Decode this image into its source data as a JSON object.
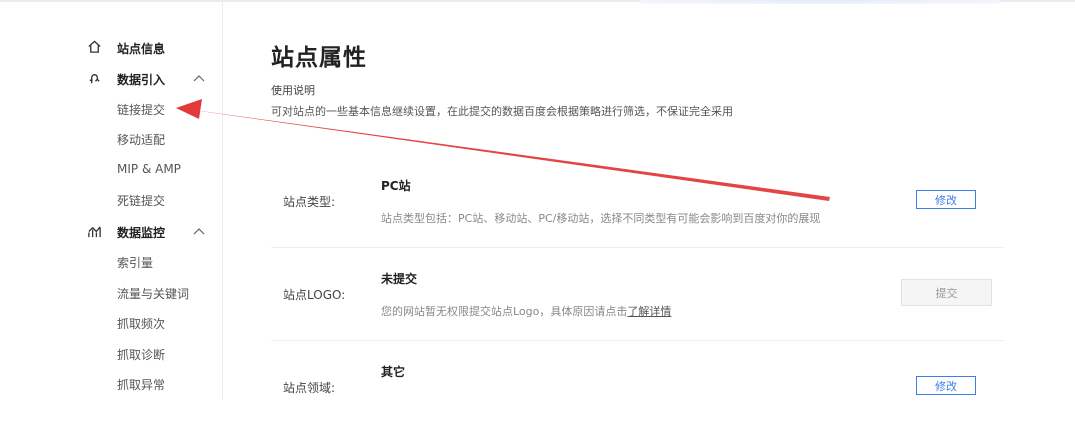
{
  "sidebar": {
    "site_info": {
      "label": "站点信息",
      "icon": "home-icon"
    },
    "data_import": {
      "label": "数据引入",
      "icon": "import-icon",
      "items": [
        "链接提交",
        "移动适配",
        "MIP & AMP",
        "死链提交"
      ]
    },
    "data_monitor": {
      "label": "数据监控",
      "icon": "chart-icon",
      "items": [
        "索引量",
        "流量与关键词",
        "抓取频次",
        "抓取诊断",
        "抓取异常"
      ]
    }
  },
  "main": {
    "title": "站点属性",
    "usage_title": "使用说明",
    "usage_desc": "可对站点的一些基本信息继续设置，在此提交的数据百度会根据策略进行筛选，不保证完全采用",
    "rows": [
      {
        "label": "站点类型:",
        "value": "PC站",
        "desc": "站点类型包括：PC站、移动站、PC/移动站，选择不同类型有可能会影响到百度对你的展现",
        "button": "修改"
      },
      {
        "label": "站点LOGO:",
        "value": "未提交",
        "desc_prefix": "您的网站暂无权限提交站点Logo，具体原因请点击",
        "desc_link": "了解详情",
        "button": "提交"
      },
      {
        "label": "站点领域:",
        "value": "其它",
        "button": "修改"
      }
    ]
  },
  "colors": {
    "accent": "#3f7ee8",
    "arrow": "#e23a3a"
  }
}
